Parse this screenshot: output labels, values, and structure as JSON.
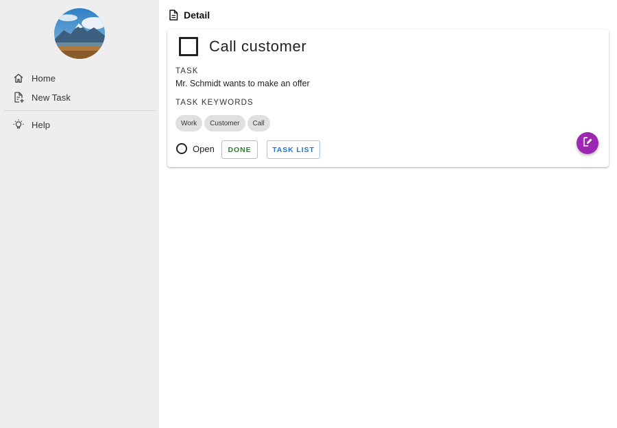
{
  "sidebar": {
    "avatar": "landscape-avatar",
    "items": [
      {
        "label": "Home",
        "icon": "home-icon"
      },
      {
        "label": "New Task",
        "icon": "new-task-icon"
      },
      {
        "label": "Help",
        "icon": "lightbulb-icon"
      }
    ]
  },
  "header": {
    "title": "Detail",
    "icon": "document-icon"
  },
  "task": {
    "title": "Call customer",
    "task_label": "TASK",
    "description": "Mr. Schmidt wants to make an offer",
    "keywords_label": "TASK KEYWORDS",
    "keywords": [
      "Work",
      "Customer",
      "Call"
    ],
    "status": "Open",
    "done_label": "DONE",
    "list_label": "TASK LIST"
  },
  "colors": {
    "sidebar_bg": "#eeeeee",
    "fab": "#9c27b0",
    "done": "#2e7d32",
    "task_list": "#1976d2",
    "chip_bg": "#e0e0e0"
  }
}
